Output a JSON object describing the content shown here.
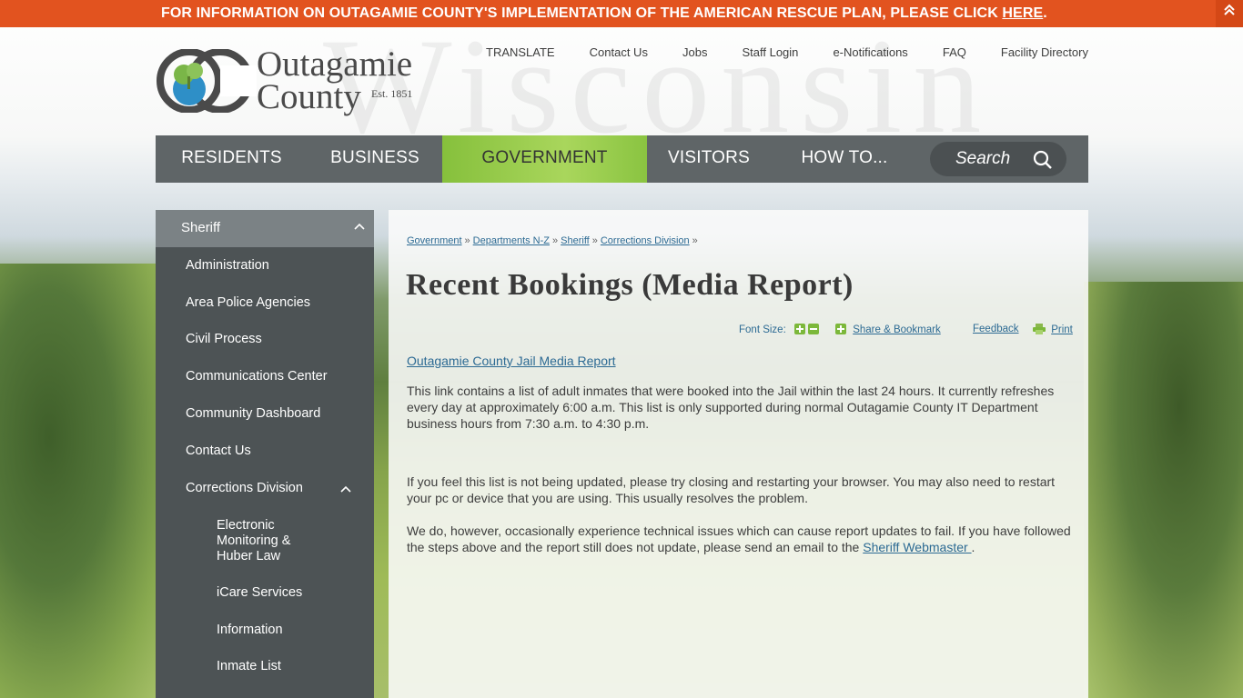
{
  "banner": {
    "text": "FOR INFORMATION ON OUTAGAMIE COUNTY'S IMPLEMENTATION OF THE AMERICAN RESCUE PLAN, PLEASE CLICK ",
    "link": "HERE",
    "end": ".",
    "toggle_icon": "double-chevron-up-icon"
  },
  "header": {
    "watermark": "Wisconsin",
    "logo": {
      "line1": "Outagamie",
      "line2": "County",
      "est": "Est. 1851"
    },
    "utility_nav": [
      "TRANSLATE",
      "Contact Us",
      "Jobs",
      "Staff Login",
      "e-Notifications",
      "FAQ",
      "Facility Directory"
    ]
  },
  "main_nav": {
    "items": [
      "RESIDENTS",
      "BUSINESS",
      "GOVERNMENT",
      "VISITORS",
      "HOW TO..."
    ],
    "active": "GOVERNMENT",
    "search_placeholder": "Search"
  },
  "sidebar": {
    "heading": "Sheriff",
    "items": [
      "Administration",
      "Area Police Agencies",
      "Civil Process",
      "Communications Center",
      "Community Dashboard",
      "Contact Us",
      "Corrections Division"
    ],
    "sub_items": [
      "Electronic Monitoring & Huber Law",
      "iCare Services",
      "Information",
      "Inmate List"
    ]
  },
  "content": {
    "breadcrumb": [
      "Government",
      "Departments N-Z",
      "Sheriff",
      "Corrections Division"
    ],
    "breadcrumb_sep": "»",
    "title": "Recent Bookings (Media Report)",
    "tools": {
      "font_size": "Font Size:",
      "share": "Share & Bookmark",
      "feedback": "Feedback",
      "print": "Print"
    },
    "report_link": "Outagamie County Jail Media Report",
    "para1": "This link contains a list of adult inmates that were booked into the Jail within the last 24 hours.  It currently refreshes every day at approximately 6:00 a.m.  This list is only supported during normal Outagamie County IT Department business hours from 7:30 a.m. to 4:30 p.m.",
    "para2": "If you feel this list is not being updated, please try closing and restarting your browser. You may also need to restart your pc or device that you are using. This usually resolves the problem.",
    "para3_pre": "We do, however, occasionally experience technical issues which can cause report updates to fail. If you have followed the steps above and the report still does not update, please send an email to the ",
    "para3_link": "Sheriff Webmaster ",
    "para3_post": "."
  },
  "colors": {
    "banner": "#e2531f",
    "nav": "#5f6567",
    "active": "#94c94a",
    "link": "#2c6a93",
    "sidebar": "#4d5355"
  }
}
